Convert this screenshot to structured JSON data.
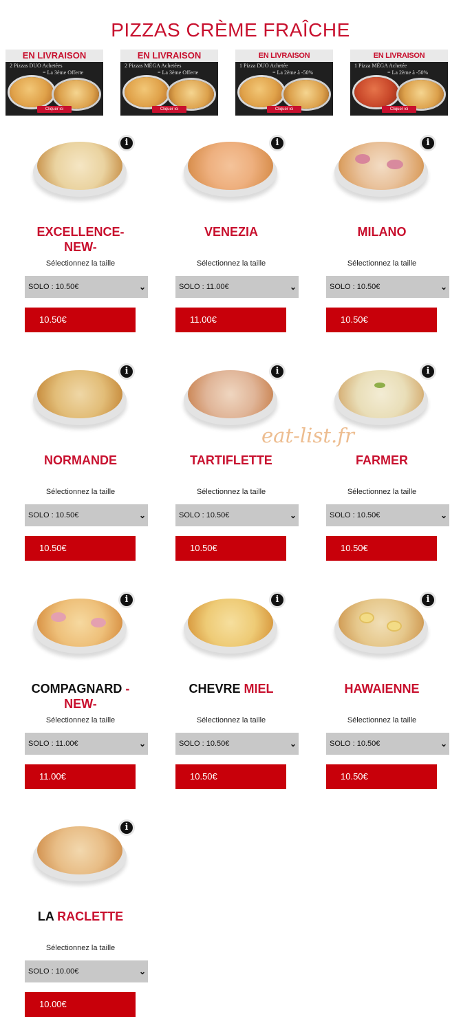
{
  "page": {
    "title": "PIZZAS CRÈME FRAÎCHE",
    "watermark": "eat-list.fr"
  },
  "promos": [
    {
      "heading": "EN LIVRAISON",
      "line1": "2 Pizzas DUO Achetées",
      "line2": "= La 3ème Offerte",
      "cta": "Cliquer ici"
    },
    {
      "heading": "EN LIVRAISON",
      "line1": "2 Pizzas MÉGA Achetées",
      "line2": "= La 3ème Offerte",
      "cta": "Cliquer ici"
    },
    {
      "heading": "EN LIVRAISON",
      "line1": "1 Pizza DUO Achetée",
      "line2": "= La 2ème à -50%",
      "cta": "Cliquer ici"
    },
    {
      "heading": "EN LIVRAISON",
      "line1": "1 Pizza MÉGA Achetée",
      "line2": "= La 2ème à -50%",
      "cta": "Cliquer ici"
    }
  ],
  "size_label": "Sélectionnez la taille",
  "pizzas": [
    {
      "name_dark": "",
      "name_red": "EXCELLENCE-NEW-",
      "select": "SOLO : 10.50€",
      "price": "10.50€"
    },
    {
      "name_dark": "",
      "name_red": "VENEZIA",
      "select": "SOLO : 11.00€",
      "price": "11.00€"
    },
    {
      "name_dark": "",
      "name_red": "MILANO",
      "select": "SOLO : 10.50€",
      "price": "10.50€"
    },
    {
      "name_dark": "",
      "name_red": "NORMANDE",
      "select": "SOLO : 10.50€",
      "price": "10.50€"
    },
    {
      "name_dark": "",
      "name_red": "TARTIFLETTE",
      "select": "SOLO : 10.50€",
      "price": "10.50€"
    },
    {
      "name_dark": "",
      "name_red": "FARMER",
      "select": "SOLO : 10.50€",
      "price": "10.50€"
    },
    {
      "name_dark": "COMPAGNARD",
      "name_red": "-NEW-",
      "select": "SOLO : 11.00€",
      "price": "11.00€"
    },
    {
      "name_dark": "CHEVRE",
      "name_red": "MIEL",
      "select": "SOLO : 10.50€",
      "price": "10.50€"
    },
    {
      "name_dark": "",
      "name_red": "HAWAIENNE",
      "select": "SOLO : 10.50€",
      "price": "10.50€"
    },
    {
      "name_dark": "LA",
      "name_red": "RACLETTE",
      "select": "SOLO : 10.00€",
      "price": "10.00€"
    }
  ],
  "icons": {
    "info": "info-icon",
    "dropdown": "chevron-down-icon"
  },
  "colors": {
    "brand_red": "#c8102e",
    "button_red": "#c8000a",
    "select_gray": "#c8c8c8"
  }
}
